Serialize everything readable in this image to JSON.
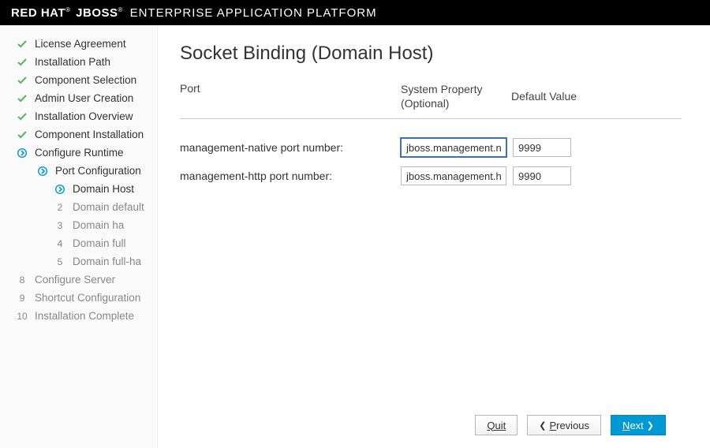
{
  "brand": {
    "redhat": "RED HAT",
    "jboss": "JBOSS",
    "eap": "ENTERPRISE APPLICATION PLATFORM"
  },
  "sidebar": {
    "steps": [
      {
        "label": "License Agreement"
      },
      {
        "label": "Installation Path"
      },
      {
        "label": "Component Selection"
      },
      {
        "label": "Admin User Creation"
      },
      {
        "label": "Installation Overview"
      },
      {
        "label": "Component Installation"
      },
      {
        "label": "Configure Runtime"
      }
    ],
    "portConfig": "Port Configuration",
    "substeps": [
      {
        "num": "",
        "label": "Domain Host",
        "active": true
      },
      {
        "num": "2",
        "label": "Domain default"
      },
      {
        "num": "3",
        "label": "Domain ha"
      },
      {
        "num": "4",
        "label": "Domain full"
      },
      {
        "num": "5",
        "label": "Domain full-ha"
      }
    ],
    "future": [
      {
        "num": "8",
        "label": "Configure Server"
      },
      {
        "num": "9",
        "label": "Shortcut Configuration"
      },
      {
        "num": "10",
        "label": "Installation Complete"
      }
    ]
  },
  "main": {
    "title": "Socket Binding (Domain Host)",
    "headers": {
      "port": "Port",
      "sys": "System Property (Optional)",
      "def": "Default Value"
    },
    "rows": [
      {
        "label": "management-native port number:",
        "sys": "jboss.management.native.port",
        "def": "9999",
        "focus": true
      },
      {
        "label": "management-http port number:",
        "sys": "jboss.management.http.port",
        "def": "9990",
        "focus": false
      }
    ]
  },
  "footer": {
    "quit": "Quit",
    "previous": "Previous",
    "next": "Next"
  }
}
